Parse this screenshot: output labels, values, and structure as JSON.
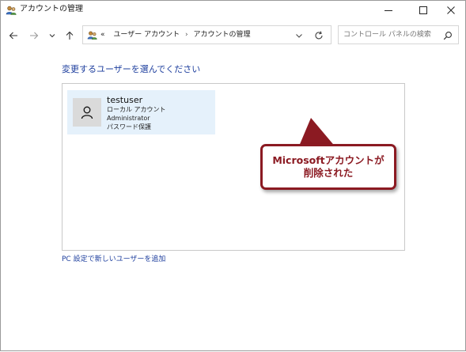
{
  "window": {
    "title": "アカウントの管理"
  },
  "address_bar": {
    "prefix": "«",
    "crumbs": [
      "ユーザー アカウント",
      "アカウントの管理"
    ]
  },
  "search": {
    "placeholder": "コントロール パネルの検索"
  },
  "main": {
    "heading": "変更するユーザーを選んでください",
    "accounts": [
      {
        "name": "testuser",
        "details": [
          "ローカル アカウント",
          "Administrator",
          "パスワード保護"
        ]
      }
    ],
    "add_user_link": "PC 設定で新しいユーザーを追加"
  },
  "annotation": {
    "lines": [
      "Microsoftアカウントが",
      "削除された"
    ],
    "color": "#8b1a22"
  },
  "icons": {
    "app": "users-icon",
    "minimize": "minimize-icon",
    "maximize": "maximize-icon",
    "close": "close-icon",
    "back": "arrow-left-icon",
    "forward": "arrow-right-icon",
    "recent": "chevron-down-icon",
    "up": "arrow-up-icon",
    "refresh": "refresh-icon",
    "search": "search-icon",
    "avatar": "user-icon"
  },
  "colors": {
    "link": "#1e3f9e",
    "tile_selected": "#e5f1fb",
    "annotation": "#8b1a22"
  }
}
